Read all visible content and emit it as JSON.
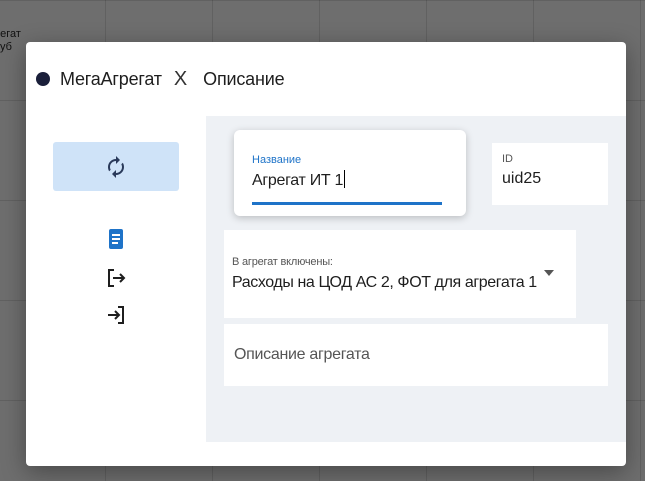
{
  "background": {
    "text_lines": [
      "регат",
      "руб"
    ]
  },
  "dialog": {
    "app_title": "МегаАгрегат",
    "close_glyph": "X",
    "section_title": "Описание"
  },
  "sidebar": {
    "items": [
      {
        "icon": "sync-icon",
        "active": true
      },
      {
        "icon": "document-icon",
        "active": false
      },
      {
        "icon": "logout-icon",
        "active": false
      },
      {
        "icon": "login-icon",
        "active": false
      }
    ]
  },
  "form": {
    "name": {
      "label": "Название",
      "value": "Агрегат ИТ 1"
    },
    "id": {
      "label": "ID",
      "value": "uid25"
    },
    "included": {
      "label": "В агрегат включены:",
      "value": "Расходы на ЦОД АС 2, ФОТ для агрегата 1"
    },
    "description": {
      "placeholder": "Описание агрегата",
      "value": ""
    }
  },
  "colors": {
    "accent": "#1e73c8",
    "active_bg": "#cfe3f8",
    "dot": "#1a1f3a",
    "panel_bg": "#eef1f5"
  }
}
